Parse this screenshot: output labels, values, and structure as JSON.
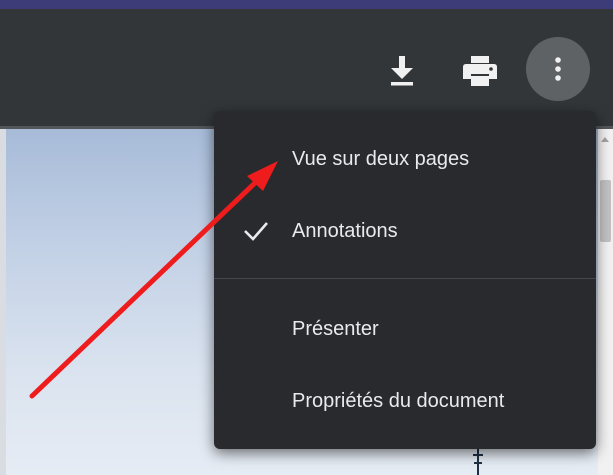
{
  "toolbar": {
    "icons": {
      "download": "download-icon",
      "print": "print-icon",
      "more": "more-vertical-icon"
    }
  },
  "menu": {
    "items": [
      {
        "label": "Vue sur deux pages",
        "checked": false
      },
      {
        "label": "Annotations",
        "checked": true
      },
      {
        "label": "Présenter",
        "checked": false
      },
      {
        "label": "Propriétés du document",
        "checked": false
      }
    ]
  },
  "colors": {
    "toolbar_bg": "#323639",
    "menu_bg": "#292a2d",
    "menu_text": "#e8eaed",
    "arrow": "#ee1c1c",
    "top_strip": "#3d3b78"
  }
}
